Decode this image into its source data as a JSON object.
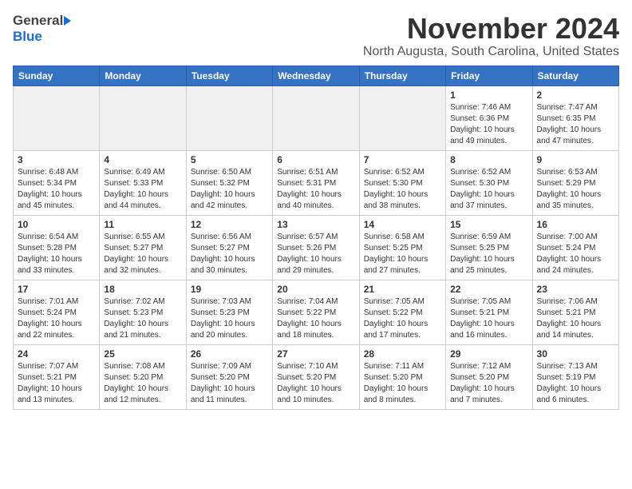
{
  "header": {
    "logo_general": "General",
    "logo_blue": "Blue",
    "month": "November 2024",
    "location": "North Augusta, South Carolina, United States"
  },
  "days_of_week": [
    "Sunday",
    "Monday",
    "Tuesday",
    "Wednesday",
    "Thursday",
    "Friday",
    "Saturday"
  ],
  "weeks": [
    [
      {
        "day": "",
        "info": ""
      },
      {
        "day": "",
        "info": ""
      },
      {
        "day": "",
        "info": ""
      },
      {
        "day": "",
        "info": ""
      },
      {
        "day": "",
        "info": ""
      },
      {
        "day": "1",
        "info": "Sunrise: 7:46 AM\nSunset: 6:36 PM\nDaylight: 10 hours\nand 49 minutes."
      },
      {
        "day": "2",
        "info": "Sunrise: 7:47 AM\nSunset: 6:35 PM\nDaylight: 10 hours\nand 47 minutes."
      }
    ],
    [
      {
        "day": "3",
        "info": "Sunrise: 6:48 AM\nSunset: 5:34 PM\nDaylight: 10 hours\nand 45 minutes."
      },
      {
        "day": "4",
        "info": "Sunrise: 6:49 AM\nSunset: 5:33 PM\nDaylight: 10 hours\nand 44 minutes."
      },
      {
        "day": "5",
        "info": "Sunrise: 6:50 AM\nSunset: 5:32 PM\nDaylight: 10 hours\nand 42 minutes."
      },
      {
        "day": "6",
        "info": "Sunrise: 6:51 AM\nSunset: 5:31 PM\nDaylight: 10 hours\nand 40 minutes."
      },
      {
        "day": "7",
        "info": "Sunrise: 6:52 AM\nSunset: 5:30 PM\nDaylight: 10 hours\nand 38 minutes."
      },
      {
        "day": "8",
        "info": "Sunrise: 6:52 AM\nSunset: 5:30 PM\nDaylight: 10 hours\nand 37 minutes."
      },
      {
        "day": "9",
        "info": "Sunrise: 6:53 AM\nSunset: 5:29 PM\nDaylight: 10 hours\nand 35 minutes."
      }
    ],
    [
      {
        "day": "10",
        "info": "Sunrise: 6:54 AM\nSunset: 5:28 PM\nDaylight: 10 hours\nand 33 minutes."
      },
      {
        "day": "11",
        "info": "Sunrise: 6:55 AM\nSunset: 5:27 PM\nDaylight: 10 hours\nand 32 minutes."
      },
      {
        "day": "12",
        "info": "Sunrise: 6:56 AM\nSunset: 5:27 PM\nDaylight: 10 hours\nand 30 minutes."
      },
      {
        "day": "13",
        "info": "Sunrise: 6:57 AM\nSunset: 5:26 PM\nDaylight: 10 hours\nand 29 minutes."
      },
      {
        "day": "14",
        "info": "Sunrise: 6:58 AM\nSunset: 5:25 PM\nDaylight: 10 hours\nand 27 minutes."
      },
      {
        "day": "15",
        "info": "Sunrise: 6:59 AM\nSunset: 5:25 PM\nDaylight: 10 hours\nand 25 minutes."
      },
      {
        "day": "16",
        "info": "Sunrise: 7:00 AM\nSunset: 5:24 PM\nDaylight: 10 hours\nand 24 minutes."
      }
    ],
    [
      {
        "day": "17",
        "info": "Sunrise: 7:01 AM\nSunset: 5:24 PM\nDaylight: 10 hours\nand 22 minutes."
      },
      {
        "day": "18",
        "info": "Sunrise: 7:02 AM\nSunset: 5:23 PM\nDaylight: 10 hours\nand 21 minutes."
      },
      {
        "day": "19",
        "info": "Sunrise: 7:03 AM\nSunset: 5:23 PM\nDaylight: 10 hours\nand 20 minutes."
      },
      {
        "day": "20",
        "info": "Sunrise: 7:04 AM\nSunset: 5:22 PM\nDaylight: 10 hours\nand 18 minutes."
      },
      {
        "day": "21",
        "info": "Sunrise: 7:05 AM\nSunset: 5:22 PM\nDaylight: 10 hours\nand 17 minutes."
      },
      {
        "day": "22",
        "info": "Sunrise: 7:05 AM\nSunset: 5:21 PM\nDaylight: 10 hours\nand 16 minutes."
      },
      {
        "day": "23",
        "info": "Sunrise: 7:06 AM\nSunset: 5:21 PM\nDaylight: 10 hours\nand 14 minutes."
      }
    ],
    [
      {
        "day": "24",
        "info": "Sunrise: 7:07 AM\nSunset: 5:21 PM\nDaylight: 10 hours\nand 13 minutes."
      },
      {
        "day": "25",
        "info": "Sunrise: 7:08 AM\nSunset: 5:20 PM\nDaylight: 10 hours\nand 12 minutes."
      },
      {
        "day": "26",
        "info": "Sunrise: 7:09 AM\nSunset: 5:20 PM\nDaylight: 10 hours\nand 11 minutes."
      },
      {
        "day": "27",
        "info": "Sunrise: 7:10 AM\nSunset: 5:20 PM\nDaylight: 10 hours\nand 10 minutes."
      },
      {
        "day": "28",
        "info": "Sunrise: 7:11 AM\nSunset: 5:20 PM\nDaylight: 10 hours\nand 8 minutes."
      },
      {
        "day": "29",
        "info": "Sunrise: 7:12 AM\nSunset: 5:20 PM\nDaylight: 10 hours\nand 7 minutes."
      },
      {
        "day": "30",
        "info": "Sunrise: 7:13 AM\nSunset: 5:19 PM\nDaylight: 10 hours\nand 6 minutes."
      }
    ]
  ]
}
